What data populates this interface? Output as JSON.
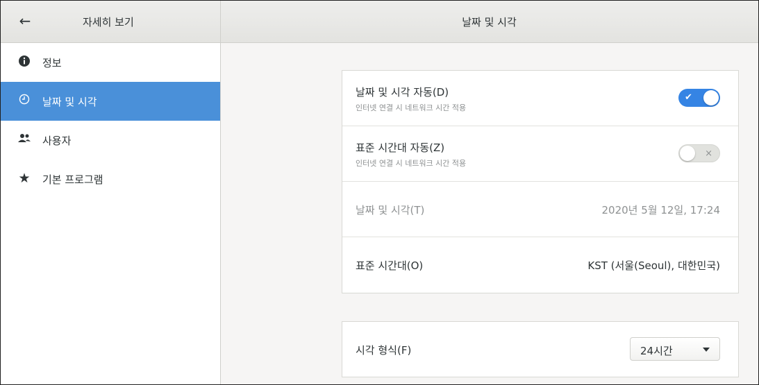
{
  "header": {
    "back_icon": "arrow-left-icon",
    "left_title": "자세히 보기",
    "title": "날짜 및 시각"
  },
  "sidebar": {
    "items": [
      {
        "label": "정보",
        "icon": "info-icon",
        "selected": false
      },
      {
        "label": "날짜 및 시각",
        "icon": "clock-icon",
        "selected": true
      },
      {
        "label": "사용자",
        "icon": "users-icon",
        "selected": false
      },
      {
        "label": "기본 프로그램",
        "icon": "star-icon",
        "selected": false
      }
    ]
  },
  "main": {
    "rows": [
      {
        "title": "날짜 및 시각 자동(D)",
        "subtitle": "인터넷 연결 시 네트워크 시간 적용",
        "switch": "on"
      },
      {
        "title": "표준 시간대 자동(Z)",
        "subtitle": "인터넷 연결 시 네트워크 시간 적용",
        "switch": "off"
      },
      {
        "title": "날짜 및 시각(T)",
        "value": "2020년 5월 12일, 17:24"
      },
      {
        "title": "표준 시간대(O)",
        "value": "KST (서울(Seoul), 대한민국)"
      }
    ],
    "time_format": {
      "title": "시각 형식(F)",
      "value": "24시간"
    }
  },
  "colors": {
    "accent": "#4a90d9",
    "switch_on": "#3584e4"
  }
}
